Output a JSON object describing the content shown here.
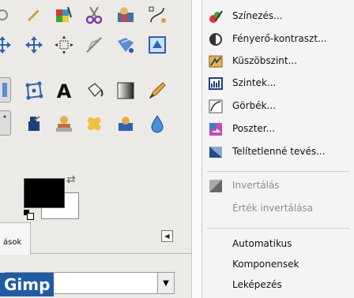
{
  "toolbox": {
    "tools": [
      {
        "name": "fuzzy-select-icon"
      },
      {
        "name": "wand-icon"
      },
      {
        "name": "color-select-icon"
      },
      {
        "name": "scissors-icon"
      },
      {
        "name": "foreground-select-icon"
      },
      {
        "name": "paths-icon"
      },
      {
        "name": "move-icon"
      },
      {
        "name": "align-icon"
      },
      {
        "name": "free-transform-icon"
      },
      {
        "name": "shear-icon"
      },
      {
        "name": "perspective-icon"
      },
      {
        "name": "flip-icon"
      },
      {
        "name": "cage-icon"
      },
      {
        "name": "text-icon"
      },
      {
        "name": "bucket-fill-icon"
      },
      {
        "name": "blend-icon"
      },
      {
        "name": "pencil-icon"
      },
      {
        "name": "ink-icon"
      },
      {
        "name": "clone-icon"
      },
      {
        "name": "heal-icon"
      },
      {
        "name": "perspective-clone-icon"
      },
      {
        "name": "blur-icon"
      }
    ],
    "dock_tab_label": "ások",
    "combo_value": "",
    "brand_label": "Gimp",
    "colors": {
      "foreground": "#000000",
      "background": "#ffffff",
      "brand": "#1f5ca8"
    }
  },
  "menu": {
    "items": [
      {
        "label": "Színezés...",
        "icon": "colorize-icon",
        "enabled": true
      },
      {
        "label": "Fényerő-kontraszt...",
        "icon": "brightness-contrast-icon",
        "enabled": true
      },
      {
        "label": "Küszöbszint...",
        "icon": "threshold-icon",
        "enabled": true
      },
      {
        "label": "Szintek...",
        "icon": "levels-icon",
        "enabled": true
      },
      {
        "label": "Görbék...",
        "icon": "curves-icon",
        "enabled": true
      },
      {
        "label": "Poszter...",
        "icon": "posterize-icon",
        "enabled": true
      },
      {
        "label": "Telítetlenné tevés...",
        "icon": "desaturate-icon",
        "enabled": true
      },
      {
        "label": "Invertálás",
        "icon": "invert-icon",
        "enabled": false
      },
      {
        "label": "Érték invertálása",
        "icon": "",
        "enabled": false
      },
      {
        "label": "Automatikus",
        "icon": "",
        "enabled": true
      },
      {
        "label": "Komponensek",
        "icon": "",
        "enabled": true
      },
      {
        "label": "Leképezés",
        "icon": "",
        "enabled": true
      }
    ]
  }
}
